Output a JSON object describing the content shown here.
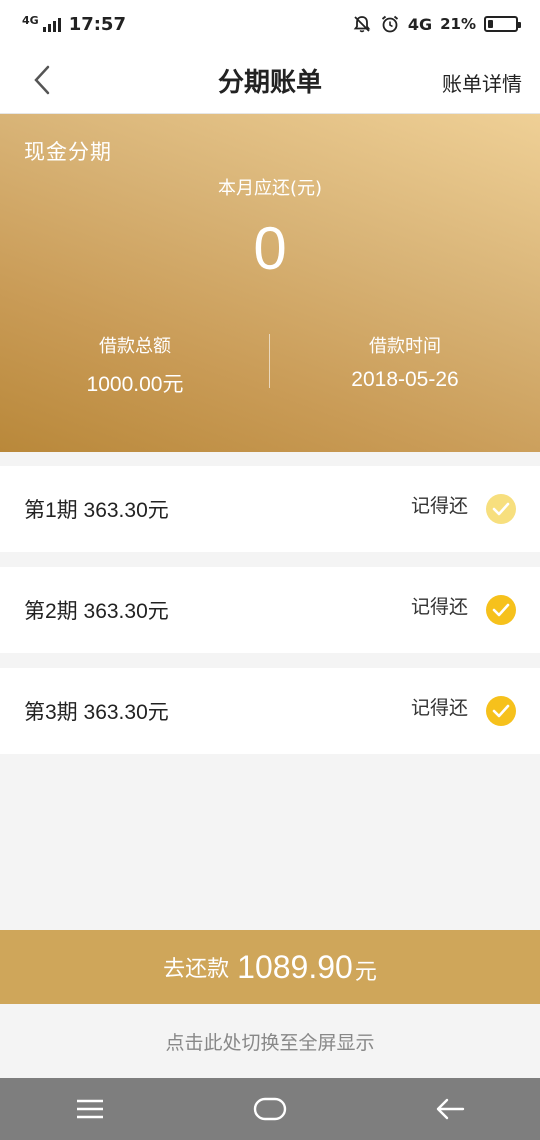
{
  "status_bar": {
    "network_left": "4G",
    "time": "17:57",
    "network_right": "4G",
    "battery": "21%",
    "battery_level": 0.21
  },
  "nav": {
    "title": "分期账单",
    "right_link": "账单详情"
  },
  "banner": {
    "type_label": "现金分期",
    "due_label": "本月应还(元)",
    "due_value": "0",
    "loan_total_label": "借款总额",
    "loan_total_value": "1000.00元",
    "loan_date_label": "借款时间",
    "loan_date_value": "2018-05-26"
  },
  "installments": [
    {
      "label": "第1期 363.30元",
      "status": "记得还",
      "check_color": "#f7df7e"
    },
    {
      "label": "第2期 363.30元",
      "status": "记得还",
      "check_color": "#f6c11c"
    },
    {
      "label": "第3期 363.30元",
      "status": "记得还",
      "check_color": "#f6c11c"
    }
  ],
  "pay": {
    "label": "去还款",
    "amount": "1089.90",
    "unit": "元"
  },
  "fullscreen_hint": "点击此处切换至全屏显示",
  "colors": {
    "gold": "#cfa65a",
    "banner_light": "#efd096",
    "banner_dark": "#b9883a",
    "system_nav": "#7e7e7e"
  }
}
